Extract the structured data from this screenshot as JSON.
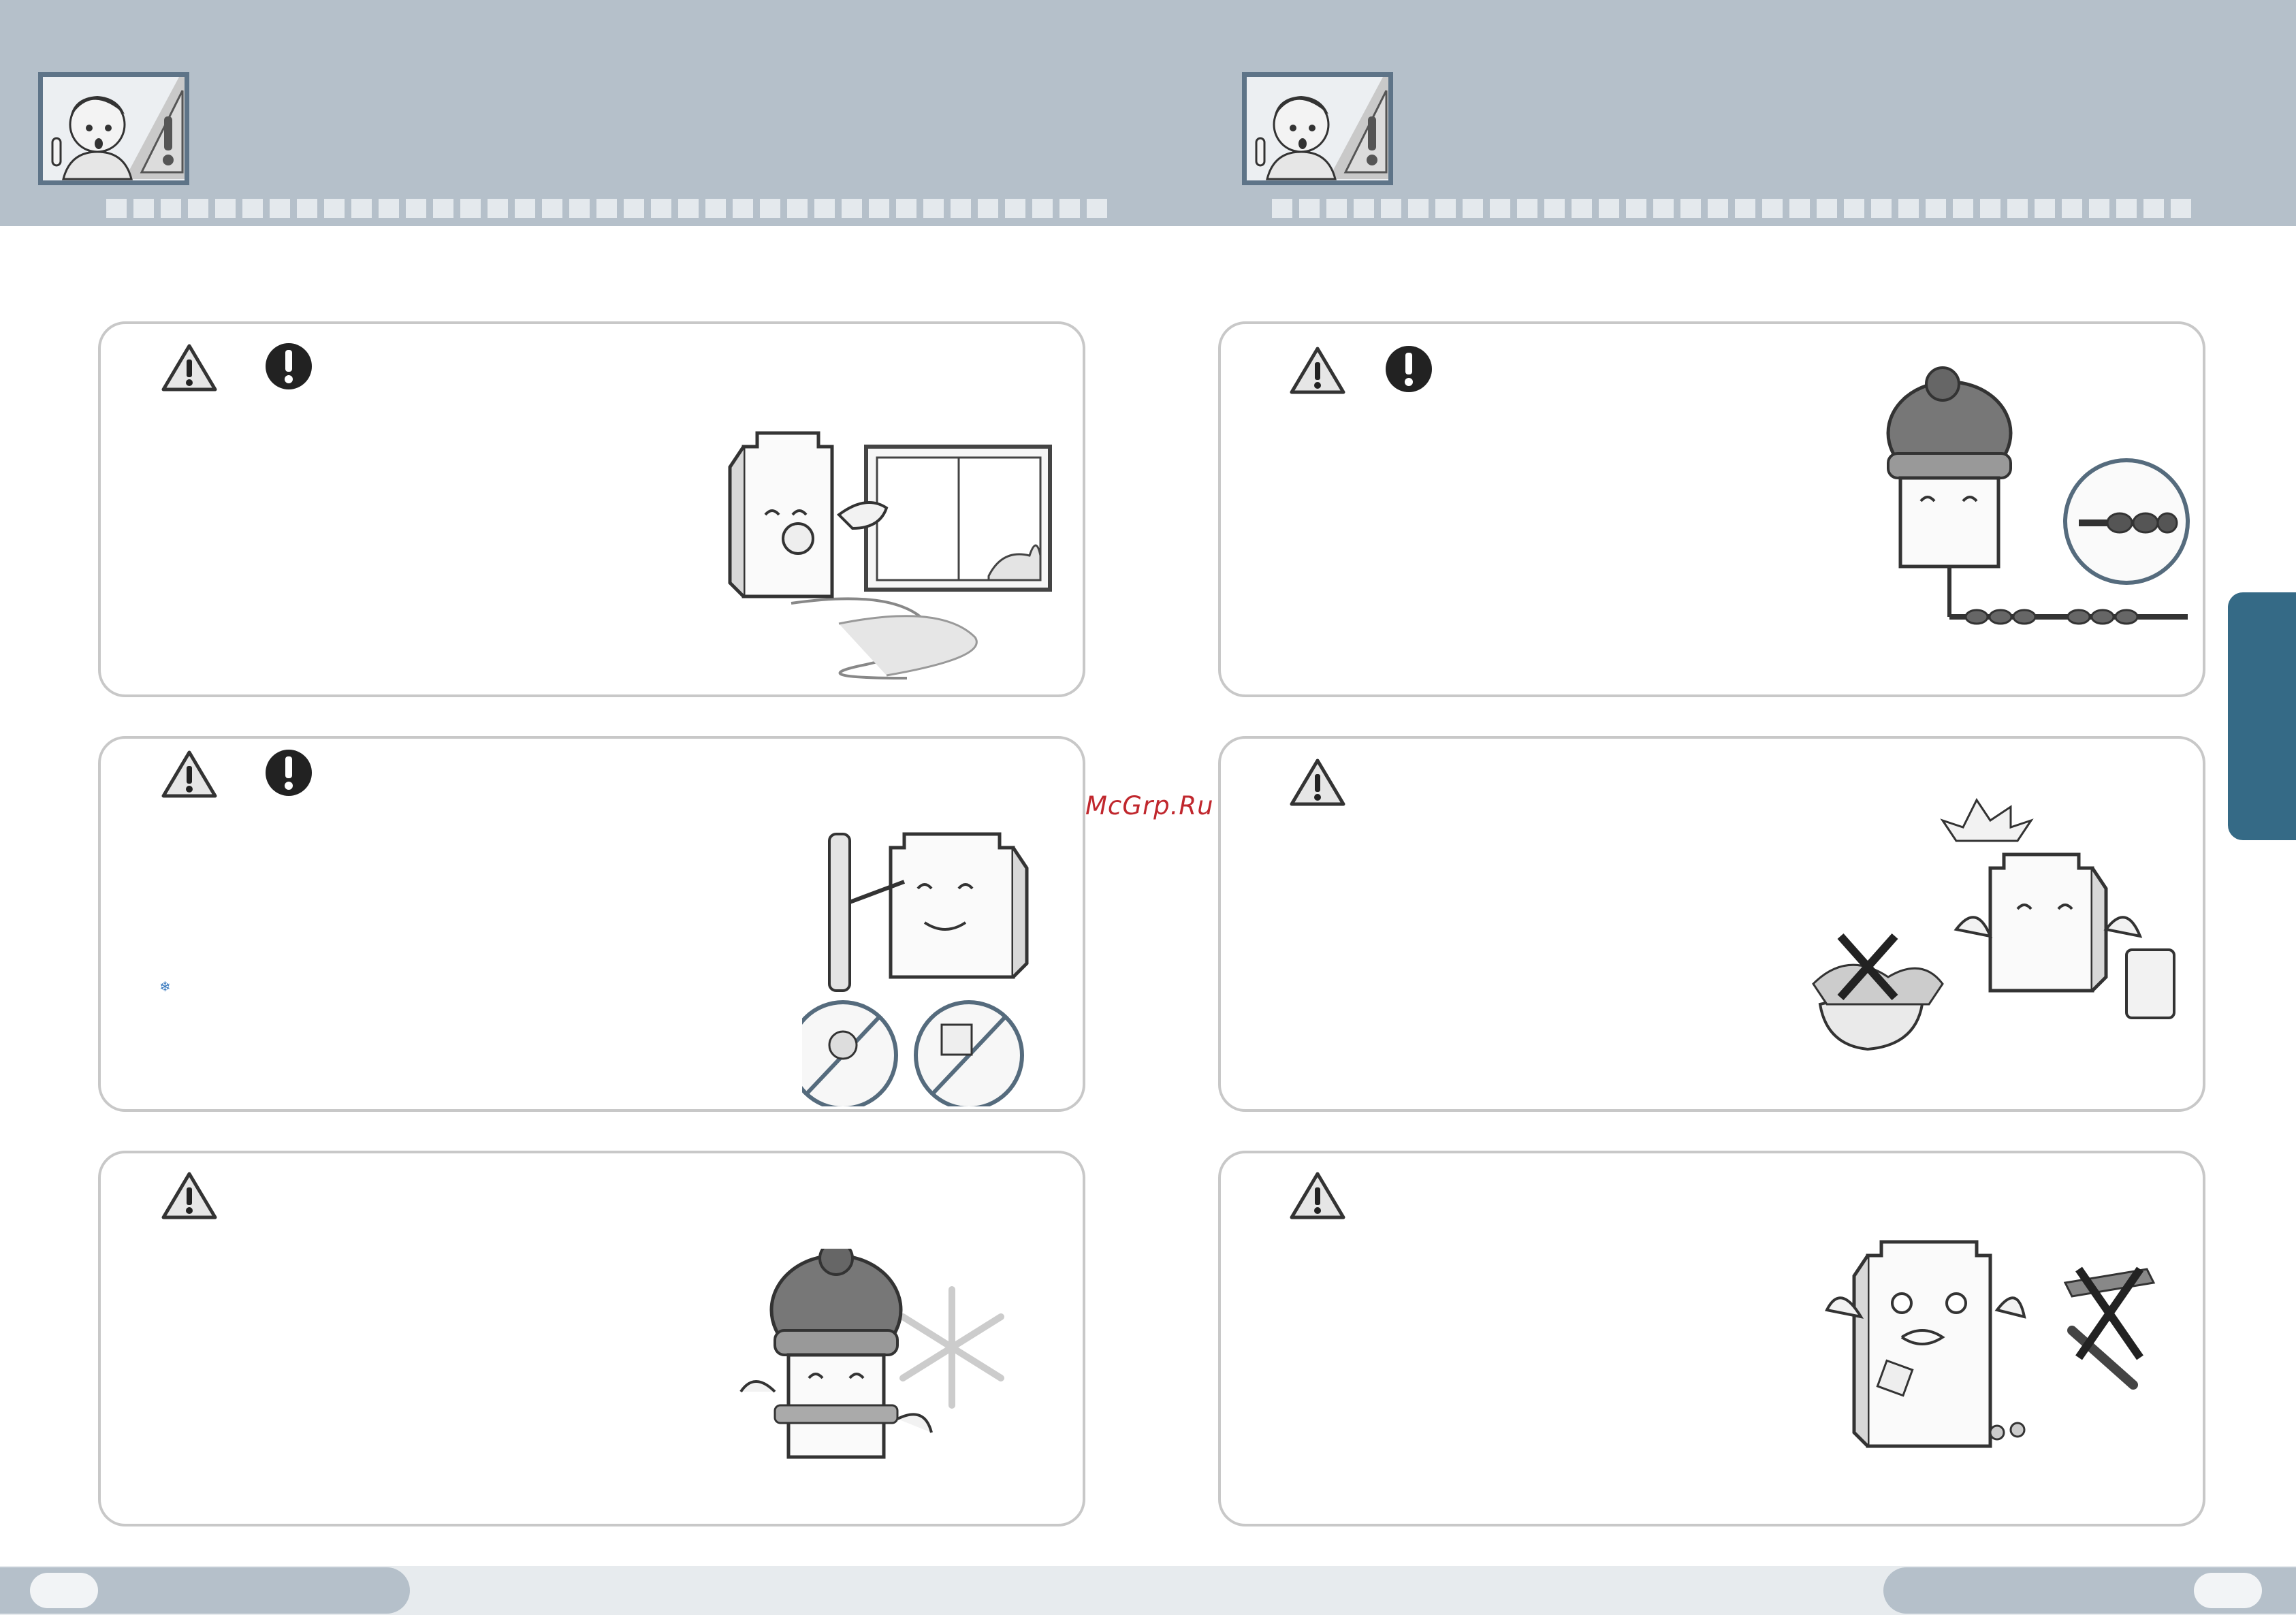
{
  "header": {
    "left_avatar_icon": "caution-person-icon",
    "right_avatar_icon": "caution-person-icon"
  },
  "cards": [
    {
      "id": "card-1",
      "icons": [
        "warning-triangle-icon",
        "mandatory-exclamation-icon"
      ],
      "illustration": "heater-with-window-icon"
    },
    {
      "id": "card-2",
      "icons": [
        "warning-triangle-icon",
        "mandatory-exclamation-icon"
      ],
      "illustration": "heater-gas-check-icon"
    },
    {
      "id": "card-3",
      "icons": [
        "warning-triangle-icon"
      ],
      "illustration": "heater-winter-icon"
    },
    {
      "id": "card-4",
      "icons": [
        "warning-triangle-icon",
        "mandatory-exclamation-icon"
      ],
      "illustration": "heater-frozen-pipe-icon"
    },
    {
      "id": "card-5",
      "icons": [
        "warning-triangle-icon"
      ],
      "illustration": "heater-no-washing-icon"
    },
    {
      "id": "card-6",
      "icons": [
        "warning-triangle-icon"
      ],
      "illustration": "heater-no-tools-icon"
    }
  ],
  "watermark": "McGrp.Ru",
  "small_glyph": "❄",
  "footer": {
    "left_page": "",
    "right_page": ""
  },
  "colors": {
    "header": "#b5c0ca",
    "tab": "#356a86",
    "watermark": "#c0272d",
    "card_border": "#c8c8c8"
  }
}
